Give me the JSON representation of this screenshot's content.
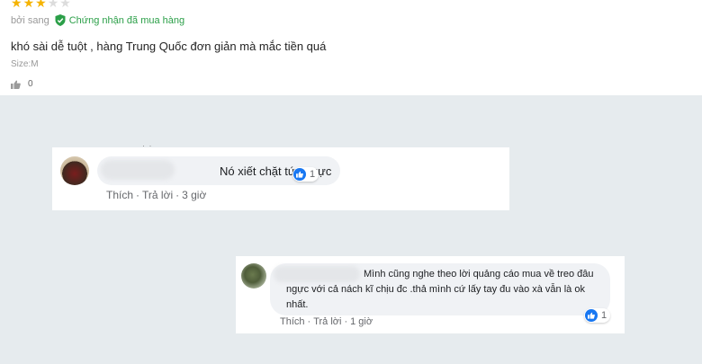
{
  "review": {
    "rating": 3,
    "max_rating": 5,
    "author": "bởi sang",
    "verified_label": "Chứng nhận đã mua hàng",
    "text": "khó sài dễ tuột , hàng Trung Quốc đơn giản mà mắc tiền quá",
    "size": "Size:M",
    "likes": "0",
    "colors": {
      "star": "#f5b301",
      "verified": "#2b9f48"
    }
  },
  "comments": [
    {
      "text": "Nó xiết chặt tức ngực",
      "reactions": "1",
      "like_label": "Thích",
      "reply_label": "Trả lời",
      "time": "3 giờ"
    },
    {
      "text": "Mình cũng nghe theo lời quảng cáo mua về treo đâu ngực với cả nách kĩ chịu đc .thả mình cứ lấy tay đu vào xà vẫn là ok nhất.",
      "reactions": "1",
      "like_label": "Thích",
      "reply_label": "Trả lời",
      "time": "1 giờ"
    }
  ],
  "icons": {
    "verified": "shield-check-icon",
    "thumb": "thumbs-up-icon",
    "reaction": "like-reaction-icon"
  }
}
